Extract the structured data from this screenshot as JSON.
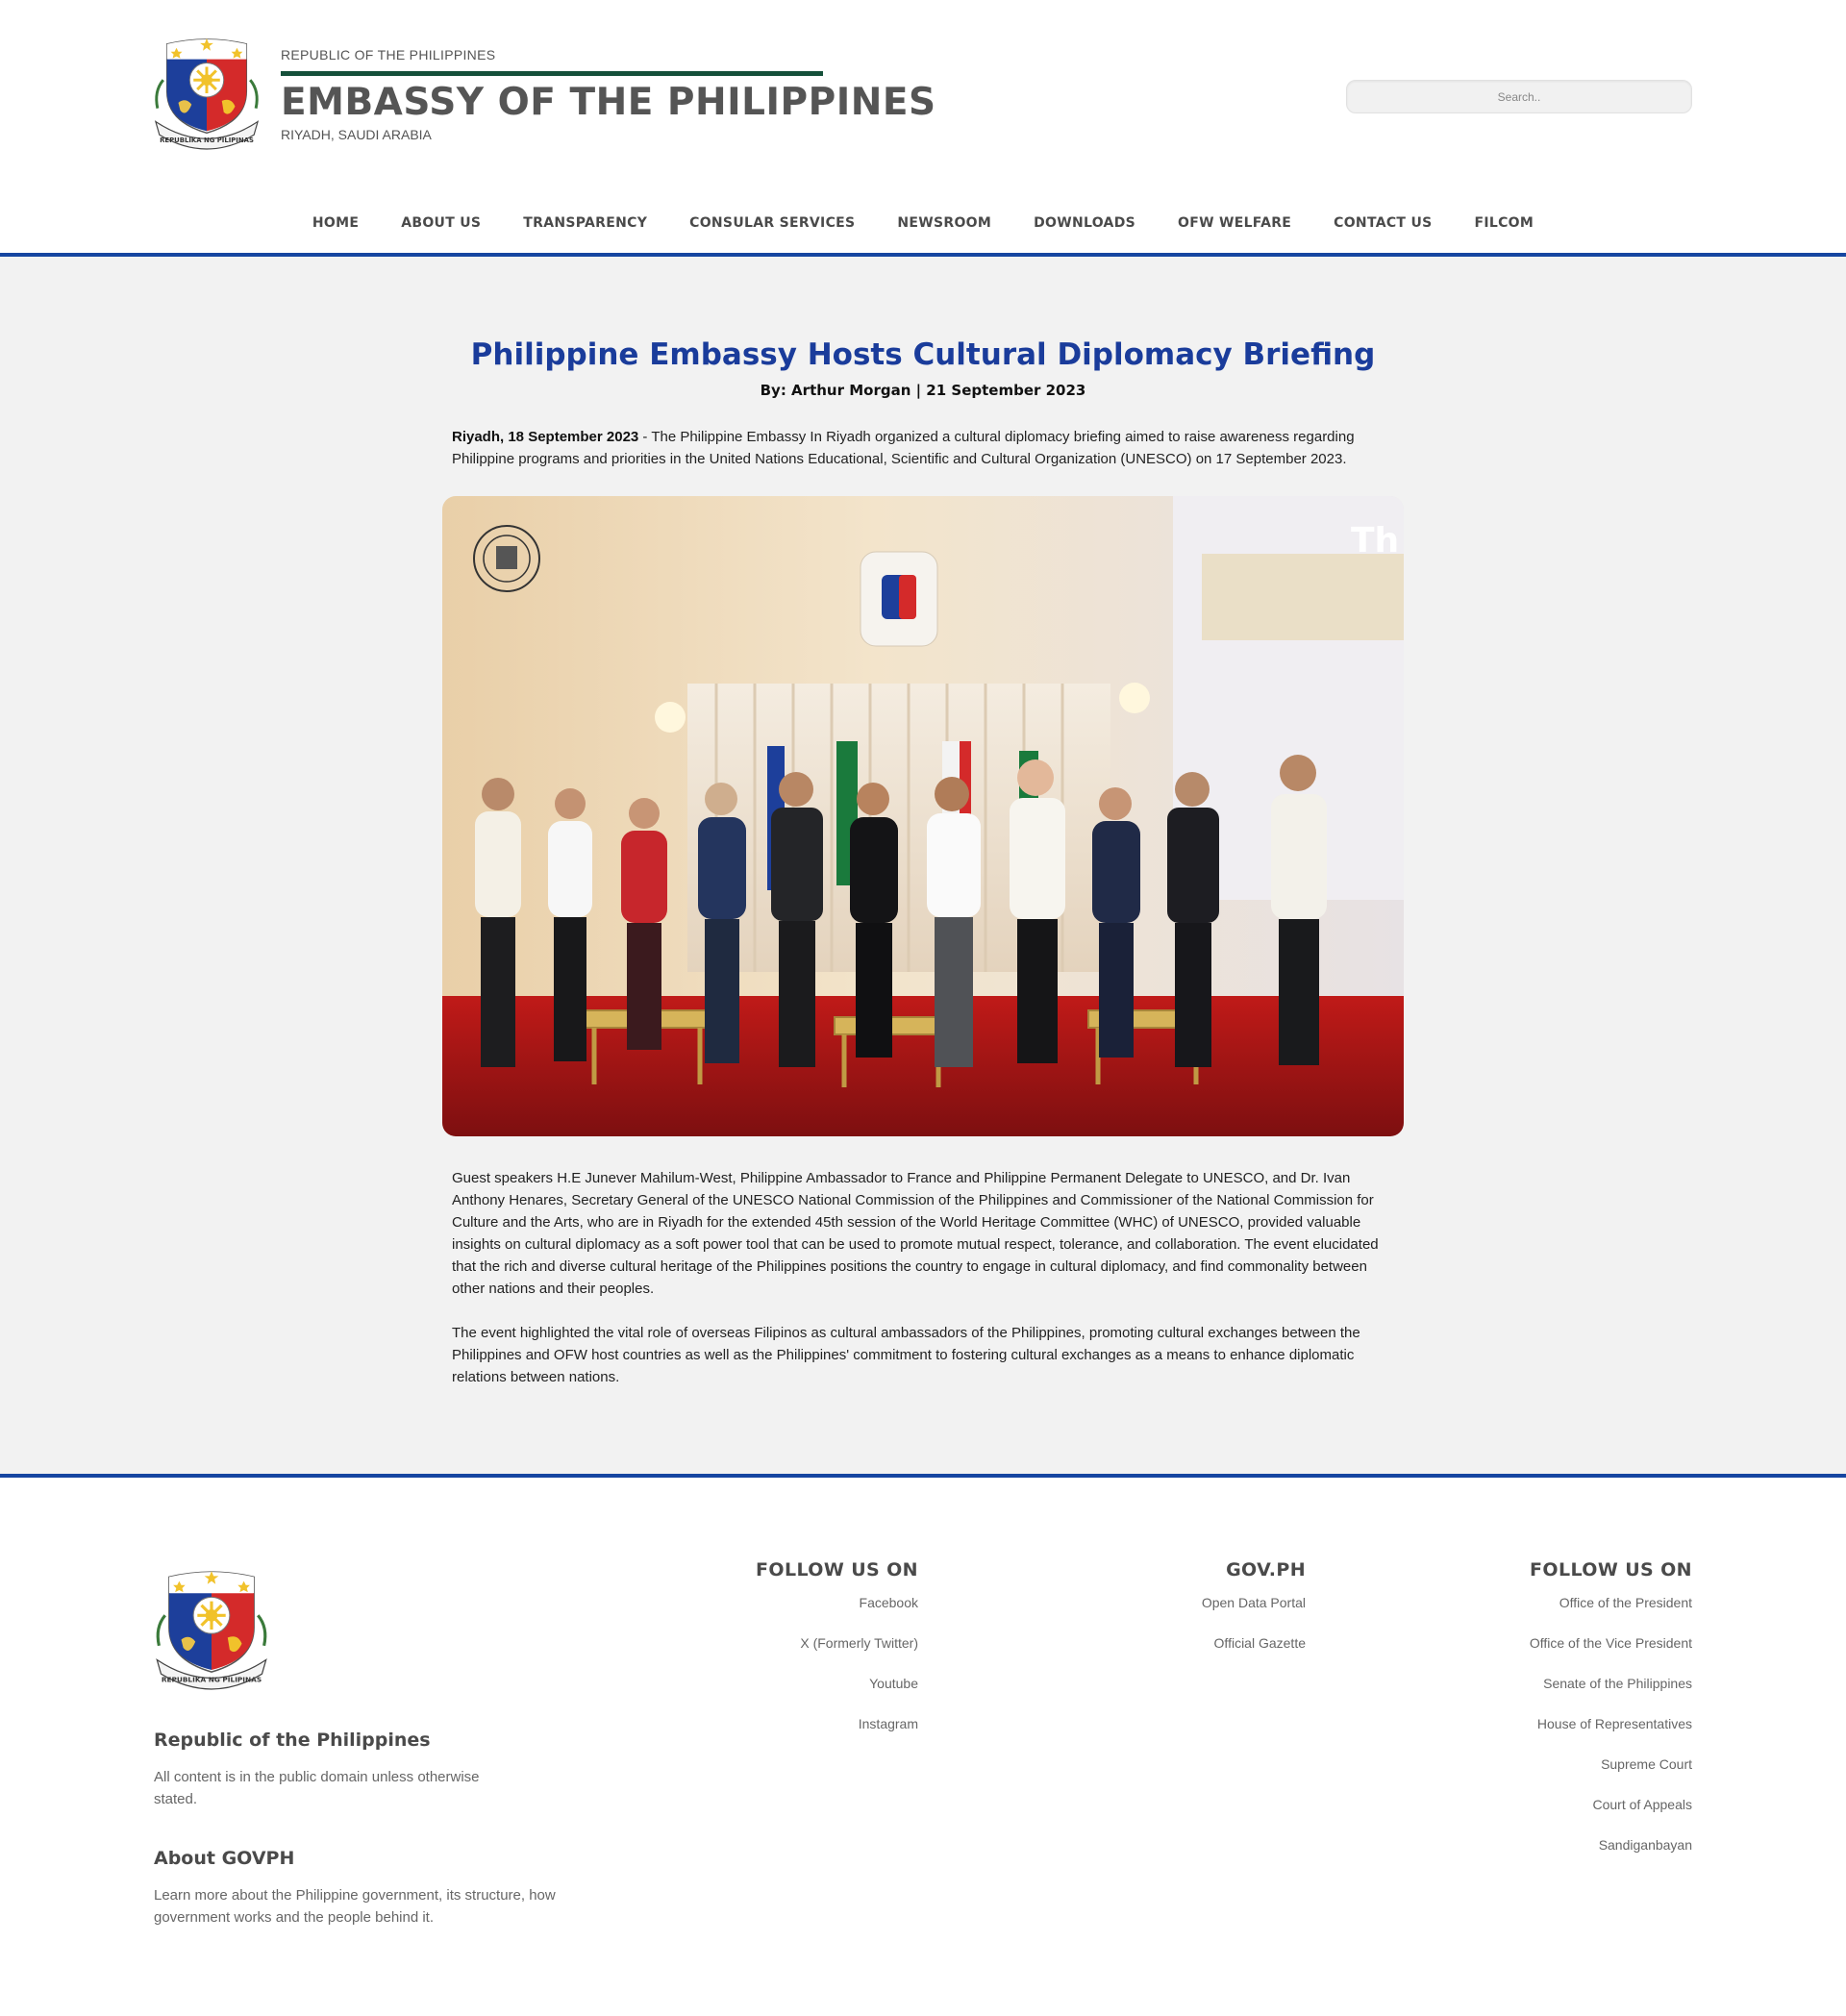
{
  "header": {
    "top_label": "REPUBLIC OF THE PHILIPPINES",
    "title": "EMBASSY OF THE PHILIPPINES",
    "subtitle": "RIYADH, SAUDI ARABIA",
    "seal_ribbon": "REPUBLIKA NG PILIPINAS",
    "search_placeholder": "Search.."
  },
  "nav": {
    "items": [
      "HOME",
      "ABOUT US",
      "TRANSPARENCY",
      "CONSULAR SERVICES",
      "NEWSROOM",
      "DOWNLOADS",
      "OFW WELFARE",
      "CONTACT US",
      "FILCOM"
    ]
  },
  "article": {
    "title": "Philippine Embassy Hosts Cultural Diplomacy Briefing",
    "byline": "By: Arthur Morgan | 21 September 2023",
    "lead_dateline": "Riyadh, 18 September 2023",
    "lead_text": " - The Philippine Embassy In Riyadh organized a cultural diplomacy briefing aimed to raise awareness regarding Philippine programs and priorities in the United Nations Educational, Scientific and Cultural Organization (UNESCO) on 17 September 2023.",
    "paragraph_2": "Guest speakers H.E Junever Mahilum-West, Philippine Ambassador to France and Philippine Permanent Delegate to UNESCO, and Dr. Ivan Anthony Henares, Secretary General of the UNESCO National Commission of the Philippines and Commissioner of the National Commission for Culture and the Arts, who are in Riyadh for the extended 45th session of the World Heritage Committee (WHC) of UNESCO, provided valuable insights on cultural diplomacy as a soft power tool that can be used to promote mutual respect, tolerance, and collaboration. The event elucidated that the rich and diverse cultural heritage of the Philippines positions the country to engage in cultural diplomacy, and find commonality between other nations and their peoples.",
    "paragraph_3": "The event highlighted the vital role of overseas Filipinos as cultural ambassadors of the Philippines, promoting cultural exchanges between the Philippines and OFW host countries as well as the Philippines' commitment to fostering cultural exchanges as a means to enhance diplomatic relations between nations.",
    "photo_screen_text": "Th"
  },
  "footer": {
    "republic_heading": "Republic of the Philippines",
    "republic_text": "All content is in the public domain unless otherwise stated.",
    "about_heading": "About GOVPH",
    "about_text": "Learn more about the Philippine government, its structure, how government works and the people behind it.",
    "columns": [
      {
        "heading": "FOLLOW US ON",
        "links": [
          "Facebook",
          "X (Formerly Twitter)",
          "Youtube",
          "Instagram"
        ]
      },
      {
        "heading": "GOV.PH",
        "links": [
          "Open Data Portal",
          "Official Gazette"
        ]
      },
      {
        "heading": "FOLLOW US ON",
        "links": [
          "Office of the President",
          "Office of the Vice President",
          "Senate of the Philippines",
          "House of Representatives",
          "Supreme Court",
          "Court of Appeals",
          "Sandiganbayan"
        ]
      }
    ]
  },
  "colors": {
    "accent_blue": "#1646a1",
    "title_blue": "#1a3c9b",
    "brand_green": "#15503a",
    "page_gray": "#f2f2f2"
  }
}
